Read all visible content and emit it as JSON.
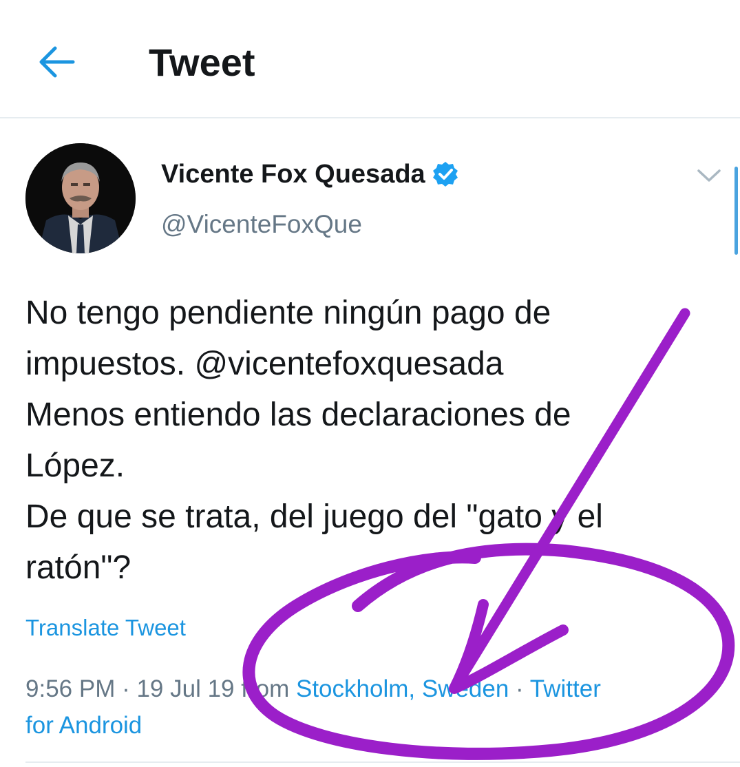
{
  "header": {
    "back_icon": "arrow-left-icon",
    "title": "Tweet"
  },
  "tweet": {
    "author": {
      "display_name": "Vicente Fox Quesada",
      "handle": "@VicenteFoxQue",
      "verified_icon": "verified-badge-icon"
    },
    "menu_icon": "chevron-down-icon",
    "text_lines": [
      "No tengo pendiente ningún pago de",
      "impuestos. @vicentefoxquesada",
      "Menos entiendo las declaraciones de",
      "López.",
      "De que se trata, del juego del \"gato y el",
      "ratón\"?"
    ],
    "translate_label": "Translate Tweet",
    "meta": {
      "time": "9:56 PM",
      "sep1": " · ",
      "date": "19 Jul 19",
      "from_label": " from ",
      "location": "Stockholm, Sweden",
      "sep2": " · ",
      "client_line1": "Twitter",
      "client_line2": "for Android"
    }
  },
  "colors": {
    "accent_blue": "#1b95e0",
    "annotation_purple": "#9b1fc9",
    "secondary_text": "#657786"
  }
}
